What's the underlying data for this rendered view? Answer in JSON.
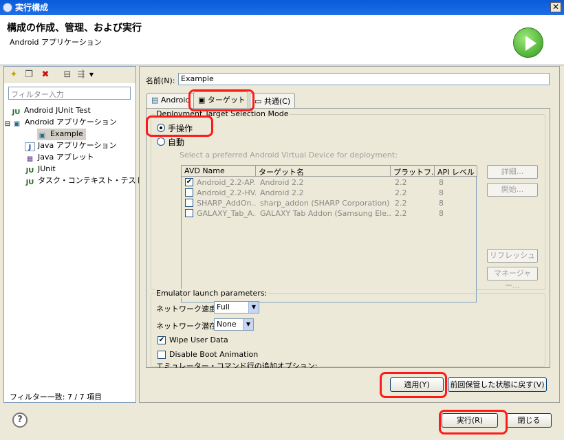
{
  "window": {
    "title": "実行構成",
    "close": "✕"
  },
  "header": {
    "title": "構成の作成、管理、および実行",
    "subtitle": "Android アプリケーション"
  },
  "left": {
    "filter_placeholder": "フィルター入力",
    "tree": [
      {
        "label": "Android JUnit Test",
        "icon": "JU"
      },
      {
        "label": "Android アプリケーション",
        "icon": "▣",
        "expanded": "⊟"
      },
      {
        "label": "Example",
        "icon": "▣",
        "selected": true
      },
      {
        "label": "Java アプリケーション",
        "icon": "J"
      },
      {
        "label": "Java アプレット",
        "icon": "▦"
      },
      {
        "label": "JUnit",
        "icon": "JU"
      },
      {
        "label": "タスク・コンテキスト・テスト",
        "icon": "JU"
      }
    ],
    "filter_count": "フィルター一致: 7 / 7 項目"
  },
  "right": {
    "name_label": "名前(N):",
    "name_value": "Example",
    "tabs": [
      "Android",
      "ターゲット",
      "共通(C)"
    ],
    "deploy_legend": "Deployment Target Selection Mode",
    "radio_manual": "手操作",
    "radio_auto": "自動",
    "avd_hint": "Select a preferred Android Virtual Device for deployment:",
    "columns": [
      "AVD Name",
      "ターゲット名",
      "プラットフ...",
      "API レベル"
    ],
    "rows": [
      {
        "name": "Android_2.2-AP...",
        "target": "Android 2.2",
        "platform": "2.2",
        "api": "8",
        "checked": "✔"
      },
      {
        "name": "Android_2.2-HV...",
        "target": "Android 2.2",
        "platform": "2.2",
        "api": "8",
        "checked": ""
      },
      {
        "name": "SHARP_AddOn...",
        "target": "sharp_addon (SHARP Corporation)",
        "platform": "2.2",
        "api": "8",
        "checked": ""
      },
      {
        "name": "GALAXY_Tab_A...",
        "target": "GALAXY Tab Addon (Samsung Ele...",
        "platform": "2.2",
        "api": "8",
        "checked": ""
      }
    ],
    "side_buttons": [
      "詳細...",
      "開始...",
      "リフレッシュ",
      "マネージャー..."
    ],
    "emu_legend": "Emulator launch parameters:",
    "net_speed_label": "ネットワーク速度:",
    "net_speed_value": "Full",
    "net_latency_label": "ネットワーク潜在:",
    "net_latency_value": "None",
    "wipe_label": "Wipe User Data",
    "wipe_check": "✔",
    "boot_anim_label": "Disable Boot Animation",
    "extra_opts_label": "エミュレーター・コマンド行の追加オプション:",
    "apply_button": "適用(Y)",
    "revert_button": "前回保管した状態に戻す(V)"
  },
  "footer": {
    "help": "?",
    "run_button": "実行(R)",
    "close_button": "閉じる"
  }
}
